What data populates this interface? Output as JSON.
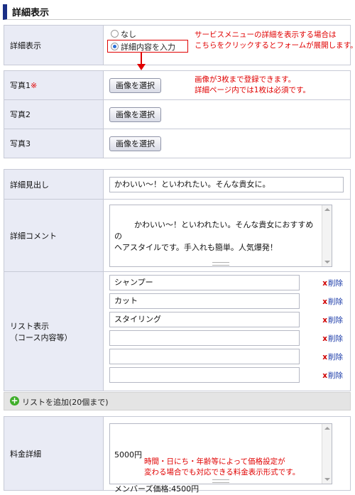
{
  "section": {
    "title": "詳細表示"
  },
  "detail_display": {
    "label": "詳細表示",
    "option_none": "なし",
    "option_input": "詳細内容を入力",
    "note": [
      "サービスメニューの詳細を表示する場合は",
      "こちらをクリックするとフォームが展開します。"
    ]
  },
  "photos": {
    "rows": [
      {
        "label": "写真1",
        "required_mark": "※",
        "button": "画像を選択"
      },
      {
        "label": "写真2",
        "required_mark": "",
        "button": "画像を選択"
      },
      {
        "label": "写真3",
        "required_mark": "",
        "button": "画像を選択"
      }
    ],
    "note": [
      "画像が3枚まで登録できます。",
      "詳細ページ内では1枚は必須です。"
    ]
  },
  "details": {
    "heading_label": "詳細見出し",
    "heading_value": "かわいい〜！といわれたい。そんな貴女に。",
    "comment_label": "詳細コメント",
    "comment_value": "かわいい〜！といわれたい。そんな貴女におすすめの\nヘアスタイルです。手入れも簡単。人気爆発！",
    "list_label_1": "リスト表示",
    "list_label_2": "（コース内容等）",
    "list_items": [
      "シャンプー",
      "カット",
      "スタイリング",
      "",
      "",
      ""
    ],
    "delete_label": "削除"
  },
  "add_list": {
    "label": "リストを追加(20個まで)"
  },
  "price": {
    "label": "料金詳細",
    "lines": [
      "5000円",
      "メンバーズ価格:4500円"
    ],
    "note": [
      "時間・日にち・年齢等によって価格設定が",
      "変わる場合でも対応できる料金表示形式です。"
    ]
  },
  "colors": {
    "accent_bar": "#1b2f86",
    "label_bg": "#e9ebf5",
    "note_red": "#e00000",
    "link_blue": "#1a3aa8",
    "add_green": "#3fae2a"
  }
}
